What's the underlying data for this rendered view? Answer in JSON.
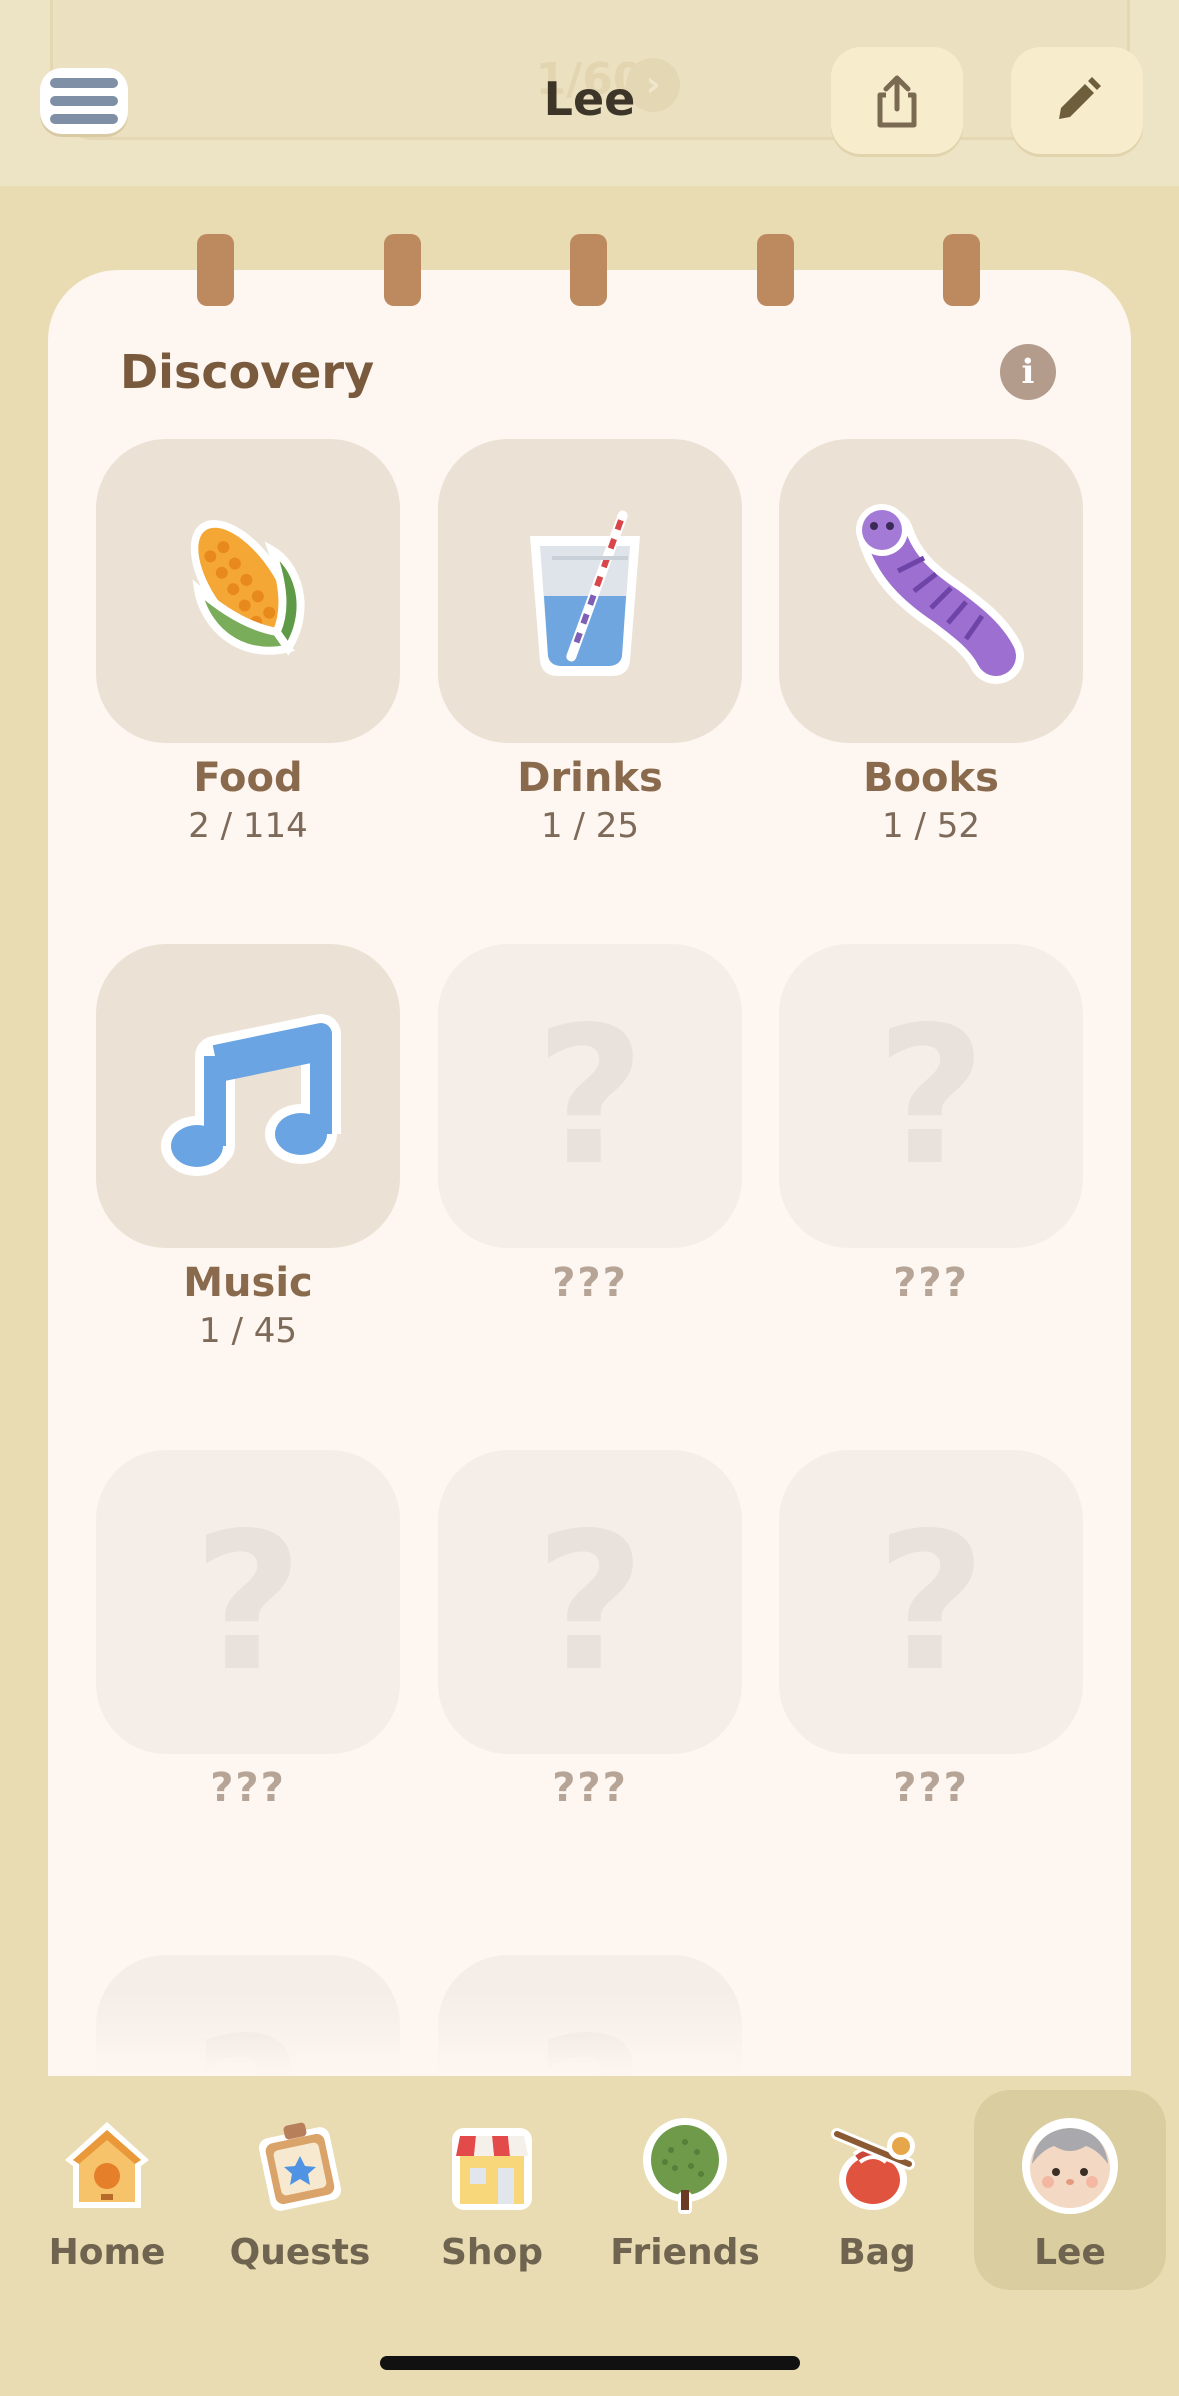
{
  "header": {
    "title": "Lee",
    "ghost_counter": "1/60",
    "menu_icon": "hamburger-menu-icon",
    "share_icon": "share-icon",
    "edit_icon": "pencil-icon"
  },
  "discovery": {
    "title": "Discovery",
    "info_glyph": "i",
    "categories": [
      {
        "name": "Food",
        "count": "2 / 114",
        "icon": "corn-icon"
      },
      {
        "name": "Drinks",
        "count": "1 / 25",
        "icon": "glass-with-straw-icon"
      },
      {
        "name": "Books",
        "count": "1 / 52",
        "icon": "caterpillar-icon"
      },
      {
        "name": "Music",
        "count": "1 / 45",
        "icon": "music-note-icon"
      },
      {
        "name": "???",
        "count": "",
        "icon": "question-mark-icon"
      },
      {
        "name": "???",
        "count": "",
        "icon": "question-mark-icon"
      },
      {
        "name": "???",
        "count": "",
        "icon": "question-mark-icon"
      },
      {
        "name": "???",
        "count": "",
        "icon": "question-mark-icon"
      },
      {
        "name": "???",
        "count": "",
        "icon": "question-mark-icon"
      }
    ],
    "locked_glyph": "?"
  },
  "nav": {
    "items": [
      {
        "label": "Home",
        "icon": "birdhouse-icon"
      },
      {
        "label": "Quests",
        "icon": "quest-board-icon"
      },
      {
        "label": "Shop",
        "icon": "shop-icon"
      },
      {
        "label": "Friends",
        "icon": "tree-icon"
      },
      {
        "label": "Bag",
        "icon": "bag-icon"
      },
      {
        "label": "Lee",
        "icon": "avatar-icon"
      }
    ],
    "active": "Lee"
  }
}
